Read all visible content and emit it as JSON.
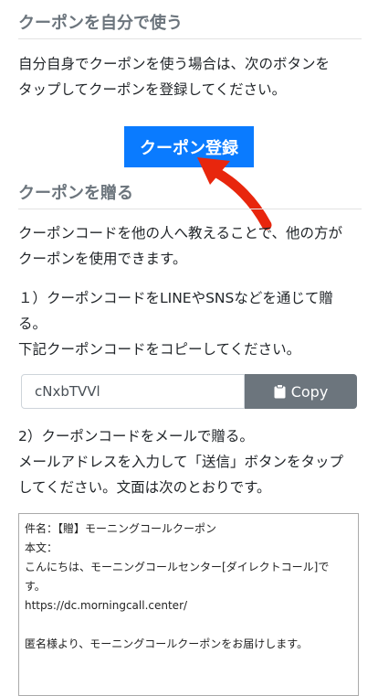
{
  "section1": {
    "heading": "クーポンを自分で使う",
    "lines": [
      "自分自身でクーポンを使う場合は、次のボタンを",
      "タップしてクーポンを登録してください。"
    ],
    "button_label": "クーポン登録"
  },
  "section2": {
    "heading": "クーポンを贈る",
    "intro_lines": [
      "クーポンコードを他の人へ教えることで、他の方が",
      "クーポンを使用できます。"
    ],
    "step1_lines": [
      "１）クーポンコードをLINEやSNSなどを通じて贈",
      "る。",
      "下記クーポンコードをコピーしてください。"
    ],
    "coupon_code": "cNxbTVVl",
    "copy_label": "Copy",
    "step2_lines": [
      "2）クーポンコードをメールで贈る。",
      "メールアドレスを入力して「送信」ボタンをタップ",
      "してください。文面は次のとおりです。"
    ],
    "mail_lines": [
      "件名：【贈】モーニングコールクーポン",
      "本文：",
      "こんにちは、モーニングコールセンター[ダイレクトコール]で",
      "す。",
      "https://dc.morningcall.center/",
      "",
      "匿名様より、モーニングコールクーポンをお届けします。"
    ]
  },
  "colors": {
    "primary": "#0a7bff",
    "secondary": "#6c757d",
    "arrow": "#e8260d"
  }
}
